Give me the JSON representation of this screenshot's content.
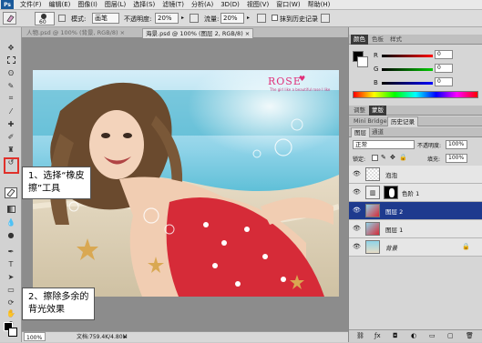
{
  "menu": [
    "文件(F)",
    "编辑(E)",
    "图像(I)",
    "图层(L)",
    "选择(S)",
    "滤镜(T)",
    "分析(A)",
    "3D(D)",
    "视图(V)",
    "窗口(W)",
    "帮助(H)"
  ],
  "options": {
    "brush_size": "60",
    "mode_label": "模式:",
    "mode_value": "画笔",
    "opacity_label": "不透明度:",
    "opacity_value": "20%",
    "flow_label": "流量:",
    "flow_value": "20%",
    "history_label": "抹到历史记录"
  },
  "doc_tabs": [
    "人物.psd @ 100% (背景, RGB/8) ×",
    "海景.psd @ 100% (图层 2, RGB/8) ×"
  ],
  "status": {
    "zoom": "100%",
    "doc": "文档:759.4K/4.80M"
  },
  "photo_logo": {
    "brand": "ROSE",
    "tagline": "The girl like a beautiful rose I like"
  },
  "callouts": {
    "step1_line1": "1、选择“橡皮",
    "step1_line2": "擦”工具",
    "step2_line1": "2、擦除多余的",
    "step2_line2": "背光效果"
  },
  "panels": {
    "color_tabs": [
      "颜色",
      "色板",
      "样式"
    ],
    "rgb": [
      {
        "label": "R",
        "value": "0"
      },
      {
        "label": "G",
        "value": "0"
      },
      {
        "label": "B",
        "value": "0"
      }
    ],
    "adjust_tabs": [
      "调整",
      "蒙版"
    ],
    "history_tabs": [
      "Mini Bridge",
      "历史记录"
    ],
    "layers_tabs": [
      "图层",
      "通道"
    ],
    "blend_mode": "正常",
    "opacity_label": "不透明度:",
    "opacity_value": "100%",
    "lock_label": "锁定:",
    "fill_label": "填充:",
    "fill_value": "100%",
    "layers": [
      {
        "name": "泡泡"
      },
      {
        "name": "色阶 1"
      },
      {
        "name": "图层 2",
        "selected": true
      },
      {
        "name": "图层 1"
      },
      {
        "name": "背景"
      }
    ]
  },
  "colors": {
    "highlight": "#e0302a",
    "selection": "#1e3a8e"
  }
}
